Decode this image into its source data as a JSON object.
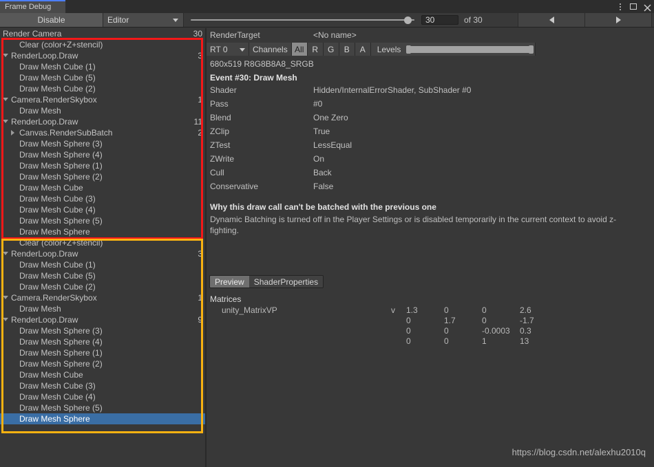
{
  "window": {
    "tab_label": "Frame Debug",
    "menu_icon": "kebab-menu-icon",
    "maximize_icon": "maximize-icon",
    "close_icon": "close-icon"
  },
  "toolbar": {
    "disable_label": "Disable",
    "target_dropdown": "Editor",
    "frame_value": "30",
    "frame_total": "of 30",
    "prev_icon": "triangle-left-icon",
    "next_icon": "triangle-right-icon"
  },
  "tree": {
    "root": {
      "label": "Render Camera",
      "count": "30",
      "indent": 4,
      "fold": "open"
    },
    "items": [
      {
        "label": "Clear (color+Z+stencil)",
        "count": "",
        "indent": 28,
        "fold": "none"
      },
      {
        "label": "RenderLoop.Draw",
        "count": "3",
        "indent": 16,
        "fold": "open"
      },
      {
        "label": "Draw Mesh Cube (1)",
        "count": "",
        "indent": 28,
        "fold": "none"
      },
      {
        "label": "Draw Mesh Cube (5)",
        "count": "",
        "indent": 28,
        "fold": "none"
      },
      {
        "label": "Draw Mesh Cube (2)",
        "count": "",
        "indent": 28,
        "fold": "none"
      },
      {
        "label": "Camera.RenderSkybox",
        "count": "1",
        "indent": 16,
        "fold": "open"
      },
      {
        "label": "Draw Mesh",
        "count": "",
        "indent": 28,
        "fold": "none"
      },
      {
        "label": "RenderLoop.Draw",
        "count": "11",
        "indent": 16,
        "fold": "open"
      },
      {
        "label": "Canvas.RenderSubBatch",
        "count": "2",
        "indent": 28,
        "fold": "closed"
      },
      {
        "label": "Draw Mesh Sphere (3)",
        "count": "",
        "indent": 28,
        "fold": "none"
      },
      {
        "label": "Draw Mesh Sphere (4)",
        "count": "",
        "indent": 28,
        "fold": "none"
      },
      {
        "label": "Draw Mesh Sphere (1)",
        "count": "",
        "indent": 28,
        "fold": "none"
      },
      {
        "label": "Draw Mesh Sphere (2)",
        "count": "",
        "indent": 28,
        "fold": "none"
      },
      {
        "label": "Draw Mesh Cube",
        "count": "",
        "indent": 28,
        "fold": "none"
      },
      {
        "label": "Draw Mesh Cube (3)",
        "count": "",
        "indent": 28,
        "fold": "none"
      },
      {
        "label": "Draw Mesh Cube (4)",
        "count": "",
        "indent": 28,
        "fold": "none"
      },
      {
        "label": "Draw Mesh Sphere (5)",
        "count": "",
        "indent": 28,
        "fold": "none"
      },
      {
        "label": "Draw Mesh Sphere",
        "count": "",
        "indent": 28,
        "fold": "none"
      },
      {
        "label": "Clear (color+Z+stencil)",
        "count": "",
        "indent": 28,
        "fold": "none"
      },
      {
        "label": "RenderLoop.Draw",
        "count": "3",
        "indent": 16,
        "fold": "open"
      },
      {
        "label": "Draw Mesh Cube (1)",
        "count": "",
        "indent": 28,
        "fold": "none"
      },
      {
        "label": "Draw Mesh Cube (5)",
        "count": "",
        "indent": 28,
        "fold": "none"
      },
      {
        "label": "Draw Mesh Cube (2)",
        "count": "",
        "indent": 28,
        "fold": "none"
      },
      {
        "label": "Camera.RenderSkybox",
        "count": "1",
        "indent": 16,
        "fold": "open"
      },
      {
        "label": "Draw Mesh",
        "count": "",
        "indent": 28,
        "fold": "none"
      },
      {
        "label": "RenderLoop.Draw",
        "count": "9",
        "indent": 16,
        "fold": "open"
      },
      {
        "label": "Draw Mesh Sphere (3)",
        "count": "",
        "indent": 28,
        "fold": "none"
      },
      {
        "label": "Draw Mesh Sphere (4)",
        "count": "",
        "indent": 28,
        "fold": "none"
      },
      {
        "label": "Draw Mesh Sphere (1)",
        "count": "",
        "indent": 28,
        "fold": "none"
      },
      {
        "label": "Draw Mesh Sphere (2)",
        "count": "",
        "indent": 28,
        "fold": "none"
      },
      {
        "label": "Draw Mesh Cube",
        "count": "",
        "indent": 28,
        "fold": "none"
      },
      {
        "label": "Draw Mesh Cube (3)",
        "count": "",
        "indent": 28,
        "fold": "none"
      },
      {
        "label": "Draw Mesh Cube (4)",
        "count": "",
        "indent": 28,
        "fold": "none"
      },
      {
        "label": "Draw Mesh Sphere (5)",
        "count": "",
        "indent": 28,
        "fold": "none"
      },
      {
        "label": "Draw Mesh Sphere",
        "count": "",
        "indent": 28,
        "fold": "none",
        "selected": true
      }
    ],
    "annotations": {
      "red_box_color": "#f41818",
      "yellow_box_color": "#f9b211",
      "selection_color": "#3a6ea5"
    }
  },
  "detail": {
    "rendertarget_label": "RenderTarget",
    "rendertarget_value": "<No name>",
    "rt_select": "RT 0",
    "channels_label": "Channels",
    "channel_buttons": [
      "All",
      "R",
      "G",
      "B",
      "A"
    ],
    "channel_active": "All",
    "levels_label": "Levels",
    "format": "680x519 R8G8B8A8_SRGB",
    "event_title": "Event #30: Draw Mesh",
    "properties": [
      {
        "key": "Shader",
        "value": "Hidden/InternalErrorShader, SubShader #0"
      },
      {
        "key": "Pass",
        "value": "#0"
      },
      {
        "key": "Blend",
        "value": "One Zero"
      },
      {
        "key": "ZClip",
        "value": "True"
      },
      {
        "key": "ZTest",
        "value": "LessEqual"
      },
      {
        "key": "ZWrite",
        "value": "On"
      },
      {
        "key": "Cull",
        "value": "Back"
      },
      {
        "key": "Conservative",
        "value": "False"
      }
    ],
    "why_title": "Why this draw call can't be batched with the previous one",
    "why_body": "Dynamic Batching is turned off in the Player Settings or is disabled temporarily in the current context to avoid z-fighting.",
    "tabs": [
      {
        "label": "Preview",
        "active": true
      },
      {
        "label": "ShaderProperties",
        "active": false
      }
    ],
    "matrices_title": "Matrices",
    "matrix_name": "unity_MatrixVP",
    "matrix_flag": "v",
    "matrix_rows": [
      [
        "1.3",
        "0",
        "0",
        "2.6"
      ],
      [
        "0",
        "1.7",
        "0",
        "-1.7"
      ],
      [
        "0",
        "0",
        "-0.0003",
        "0.3"
      ],
      [
        "0",
        "0",
        "1",
        "13"
      ]
    ]
  },
  "watermark": "https://blog.csdn.net/alexhu2010q"
}
